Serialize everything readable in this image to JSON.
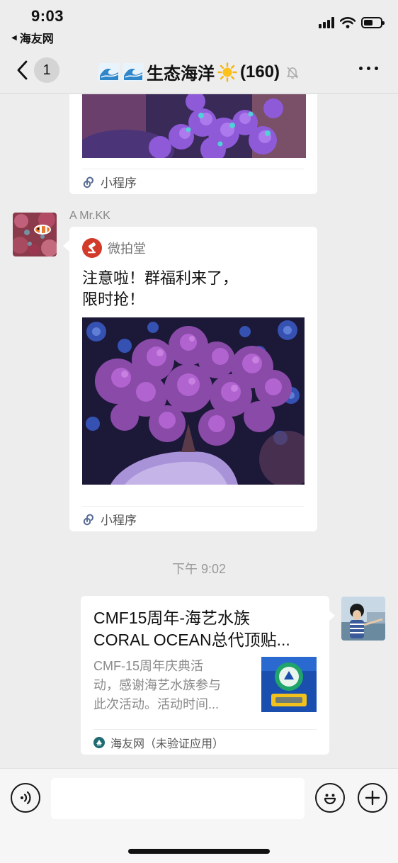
{
  "status_bar": {
    "time": "9:03",
    "back_app": "海友网",
    "battery_level": 0.55
  },
  "nav": {
    "back_count": "1",
    "group_name": "生态海洋",
    "member_count": "(160)",
    "title_icons": [
      "wave-emoji",
      "wave-emoji",
      "sun-emoji",
      "mute-bell-icon"
    ]
  },
  "messages": {
    "first_card": {
      "footer_label": "小程序"
    },
    "second_message": {
      "sender": "A  Mr.KK",
      "source_name": "微拍堂",
      "text_line1": "注意啦！群福利来了，",
      "text_line2": "限时抢！",
      "footer_label": "小程序"
    },
    "timestamp": "下午 9:02",
    "article": {
      "title_line1": "CMF15周年-海艺水族",
      "title_line2": "CORAL OCEAN总代顶贴...",
      "desc_line1": "CMF-15周年庆典活",
      "desc_line2": "动，感谢海艺水族参与",
      "desc_line3": "此次活动。活动时间...",
      "source": "海友网（未验证应用）"
    }
  },
  "input_bar": {
    "placeholder": ""
  },
  "colors": {
    "background": "#ededed",
    "bubble": "#ffffff",
    "meta_text": "#888888",
    "link_icon": "#576b95"
  }
}
